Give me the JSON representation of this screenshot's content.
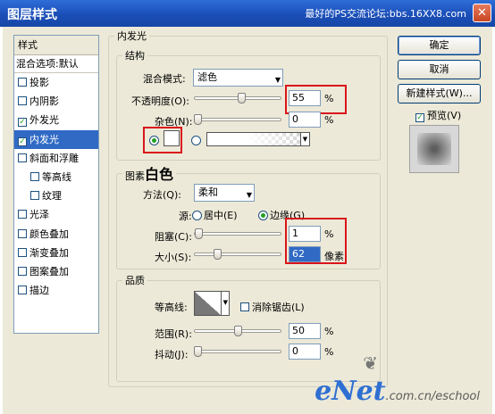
{
  "window": {
    "title": "图层样式",
    "watermark": "最好的PS交流论坛:bbs.16XX8.com",
    "close_glyph": "✕"
  },
  "sidebar": {
    "header": "样式",
    "blend_options": "混合选项:默认",
    "items": [
      {
        "label": "投影",
        "checked": false,
        "sub": false
      },
      {
        "label": "内阴影",
        "checked": false,
        "sub": false
      },
      {
        "label": "外发光",
        "checked": true,
        "sub": false
      },
      {
        "label": "内发光",
        "checked": true,
        "sub": false,
        "selected": true
      },
      {
        "label": "斜面和浮雕",
        "checked": false,
        "sub": false
      },
      {
        "label": "等高线",
        "checked": false,
        "sub": true
      },
      {
        "label": "纹理",
        "checked": false,
        "sub": true
      },
      {
        "label": "光泽",
        "checked": false,
        "sub": false
      },
      {
        "label": "颜色叠加",
        "checked": false,
        "sub": false
      },
      {
        "label": "渐变叠加",
        "checked": false,
        "sub": false
      },
      {
        "label": "图案叠加",
        "checked": false,
        "sub": false
      },
      {
        "label": "描边",
        "checked": false,
        "sub": false
      }
    ]
  },
  "panel": {
    "title": "内发光",
    "structure": {
      "legend": "结构",
      "blend_mode_label": "混合模式:",
      "blend_mode_value": "滤色",
      "opacity_label": "不透明度(O):",
      "opacity_value": "55",
      "opacity_unit": "%",
      "opacity_level": 55,
      "noise_label": "杂色(N):",
      "noise_value": "0",
      "noise_unit": "%",
      "noise_level": 0
    },
    "elements": {
      "legend": "图素",
      "annotation": "白色",
      "technique_label": "方法(Q):",
      "technique_value": "柔和",
      "source_label": "源:",
      "source_center": "居中(E)",
      "source_edge": "边缘(G)",
      "choke_label": "阻塞(C):",
      "choke_value": "1",
      "choke_unit": "%",
      "choke_level": 1,
      "size_label": "大小(S):",
      "size_value": "62",
      "size_unit": "像素",
      "size_level": 25
    },
    "quality": {
      "legend": "品质",
      "contour_label": "等高线:",
      "antialias_label": "消除锯齿(L)",
      "range_label": "范围(R):",
      "range_value": "50",
      "range_unit": "%",
      "range_level": 50,
      "jitter_label": "抖动(J):",
      "jitter_value": "0",
      "jitter_unit": "%",
      "jitter_level": 0
    }
  },
  "buttons": {
    "ok": "确定",
    "cancel": "取消",
    "new_style": "新建样式(W)...",
    "preview_label": "预览(V)",
    "preview_checked": true
  },
  "logo": {
    "big": "eNet",
    "small": ".com.cn/eschool"
  },
  "colors": {
    "accent": "#316ac5",
    "highlight_box": "#d9141a",
    "titlebar": "#1b4fb8"
  }
}
